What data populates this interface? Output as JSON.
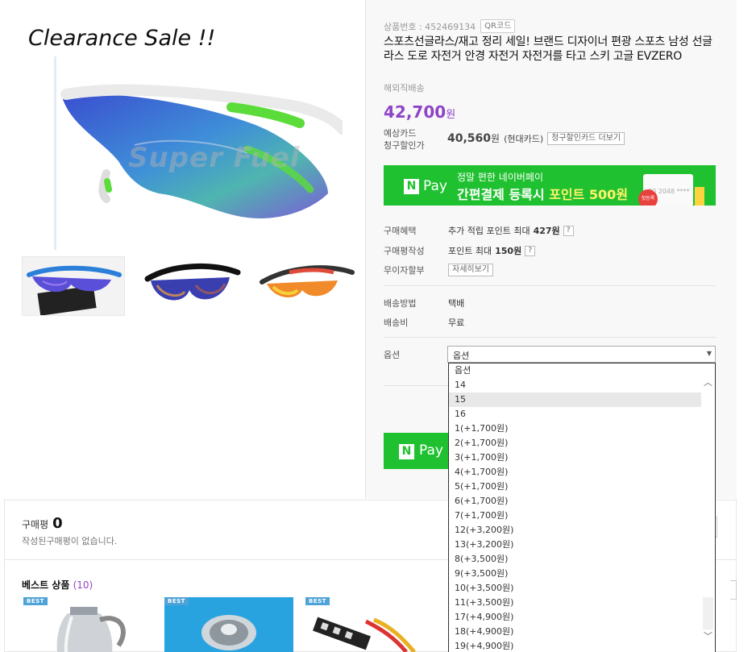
{
  "gallery": {
    "sale_text": "Clearance Sale !!",
    "watermark": "Super Fuel"
  },
  "product": {
    "number_label": "상품번호 : 452469134",
    "qr_label": "QR코드",
    "title": "스포츠선글라스/재고 정리 세일! 브랜드 디자이너 편광 스포츠 남성 선글라스 도로 자전거 안경 자전거 자전거를 타고 스키 고글 EVZERO",
    "origin": "해외직배송",
    "price": "42,700",
    "price_unit": "원",
    "card_label_1": "예상카드",
    "card_label_2": "청구할인가",
    "card_price": "40,560",
    "card_price_unit": "원",
    "card_brand": "(현대카드)",
    "card_more": "청구할인카드 더보기"
  },
  "npay_banner": {
    "logo_n": "N",
    "logo_pay": "Pay",
    "line1": "정말 편한 네이버페이",
    "line2_a": "간편결제 등록시 ",
    "line2_b": "포인트 500원",
    "card_number": "00 2048 ****",
    "badge": "첫등록"
  },
  "rows": {
    "benefit_label": "구매혜택",
    "benefit_value": "추가 적립 포인트 최대 ",
    "benefit_points": "427원",
    "review_label": "구매평작성",
    "review_value": "포인트 최대 ",
    "review_points": "150원",
    "installment_label": "무이자할부",
    "installment_btn": "자세히보기",
    "delivery_label": "배송방법",
    "delivery_value": "택배",
    "fee_label": "배송비",
    "fee_value": "무료",
    "help_mark": "?"
  },
  "option": {
    "label": "옵션",
    "selected": "옵션",
    "items": [
      "옵션",
      "14",
      "15",
      "16",
      "1(+1,700원)",
      "2(+1,700원)",
      "3(+1,700원)",
      "4(+1,700원)",
      "5(+1,700원)",
      "6(+1,700원)",
      "7(+1,700원)",
      "12(+3,200원)",
      "13(+3,200원)",
      "8(+3,500원)",
      "9(+3,500원)",
      "10(+3,500원)",
      "11(+3,500원)",
      "17(+4,900원)",
      "18(+4,900원)",
      "19(+4,900원)"
    ],
    "highlighted_index": 2
  },
  "npay_buy": {
    "n": "N",
    "pay": "Pay"
  },
  "review": {
    "title": "구매평",
    "count": "0",
    "empty": "작성된구매평이 없습니다."
  },
  "best": {
    "title": "베스트 상품",
    "count": "(10)",
    "tag": "BEST"
  },
  "colors": {
    "accent_purple": "#8e44c8",
    "naver_green": "#20c130",
    "best_tag": "#4fa3d8"
  }
}
